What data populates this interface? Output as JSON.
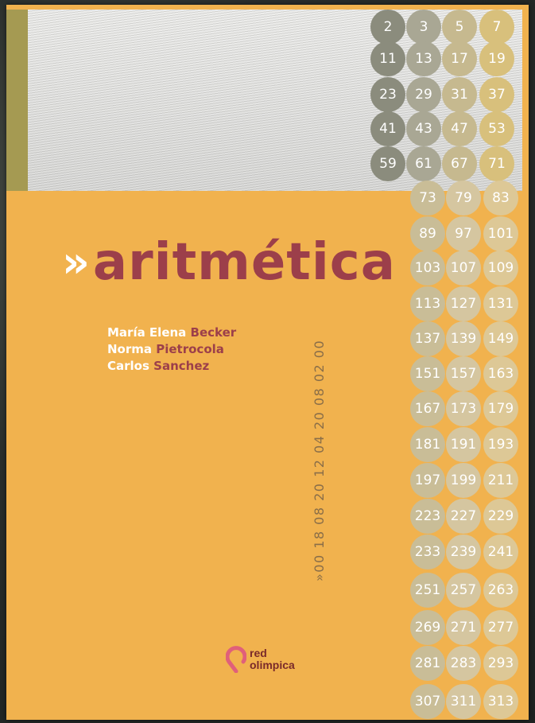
{
  "cover": {
    "title": "aritmética",
    "title_prefix": "»",
    "authors": [
      {
        "first": "María Elena",
        "last": "Becker"
      },
      {
        "first": "Norma",
        "last": "Pietrocola"
      },
      {
        "first": "Carlos",
        "last": "Sanchez"
      }
    ],
    "vertical_code": "»00 18 08 20 12 04 20 08 02 00",
    "publisher": {
      "line1": "red",
      "line2": "olimpica"
    },
    "primes": [
      2,
      3,
      5,
      7,
      11,
      13,
      17,
      19,
      23,
      29,
      31,
      37,
      41,
      43,
      47,
      53,
      59,
      61,
      67,
      71,
      73,
      79,
      83,
      89,
      97,
      101,
      103,
      107,
      109,
      113,
      127,
      131,
      137,
      139,
      149,
      151,
      157,
      163,
      167,
      173,
      179,
      181,
      191,
      193,
      197,
      199,
      211,
      223,
      227,
      229,
      233,
      239,
      241,
      251,
      257,
      263,
      269,
      271,
      277,
      281,
      283,
      293,
      307,
      311,
      313
    ],
    "colors": {
      "cover": "#f1b24e",
      "title": "#9c3f4a",
      "background": "#2a2e2c"
    }
  }
}
